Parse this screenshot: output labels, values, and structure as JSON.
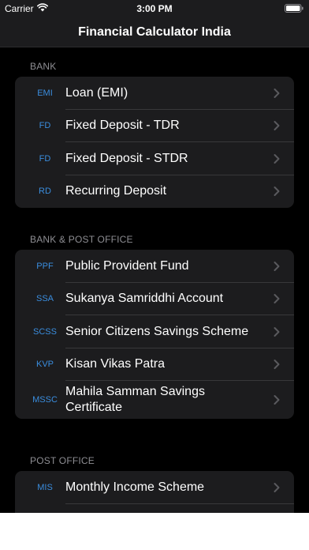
{
  "status_bar": {
    "carrier": "Carrier",
    "time": "3:00 PM"
  },
  "nav": {
    "title": "Financial Calculator India"
  },
  "sections": [
    {
      "header": "BANK",
      "rows": [
        {
          "abbr": "EMI",
          "label": "Loan (EMI)"
        },
        {
          "abbr": "FD",
          "label": "Fixed Deposit - TDR"
        },
        {
          "abbr": "FD",
          "label": "Fixed Deposit - STDR"
        },
        {
          "abbr": "RD",
          "label": "Recurring Deposit"
        }
      ]
    },
    {
      "header": "BANK & POST OFFICE",
      "rows": [
        {
          "abbr": "PPF",
          "label": "Public Provident Fund"
        },
        {
          "abbr": "SSA",
          "label": "Sukanya Samriddhi Account"
        },
        {
          "abbr": "SCSS",
          "label": "Senior Citizens Savings Scheme"
        },
        {
          "abbr": "KVP",
          "label": "Kisan Vikas Patra"
        },
        {
          "abbr": "MSSC",
          "label": "Mahila Samman Savings Certificate"
        }
      ]
    },
    {
      "header": "POST OFFICE",
      "rows": [
        {
          "abbr": "MIS",
          "label": "Monthly Income Scheme"
        }
      ]
    }
  ],
  "colors": {
    "accent": "#3a8dde",
    "background": "#000000",
    "cell": "#1c1c1e",
    "secondary_text": "#8e8e93"
  }
}
